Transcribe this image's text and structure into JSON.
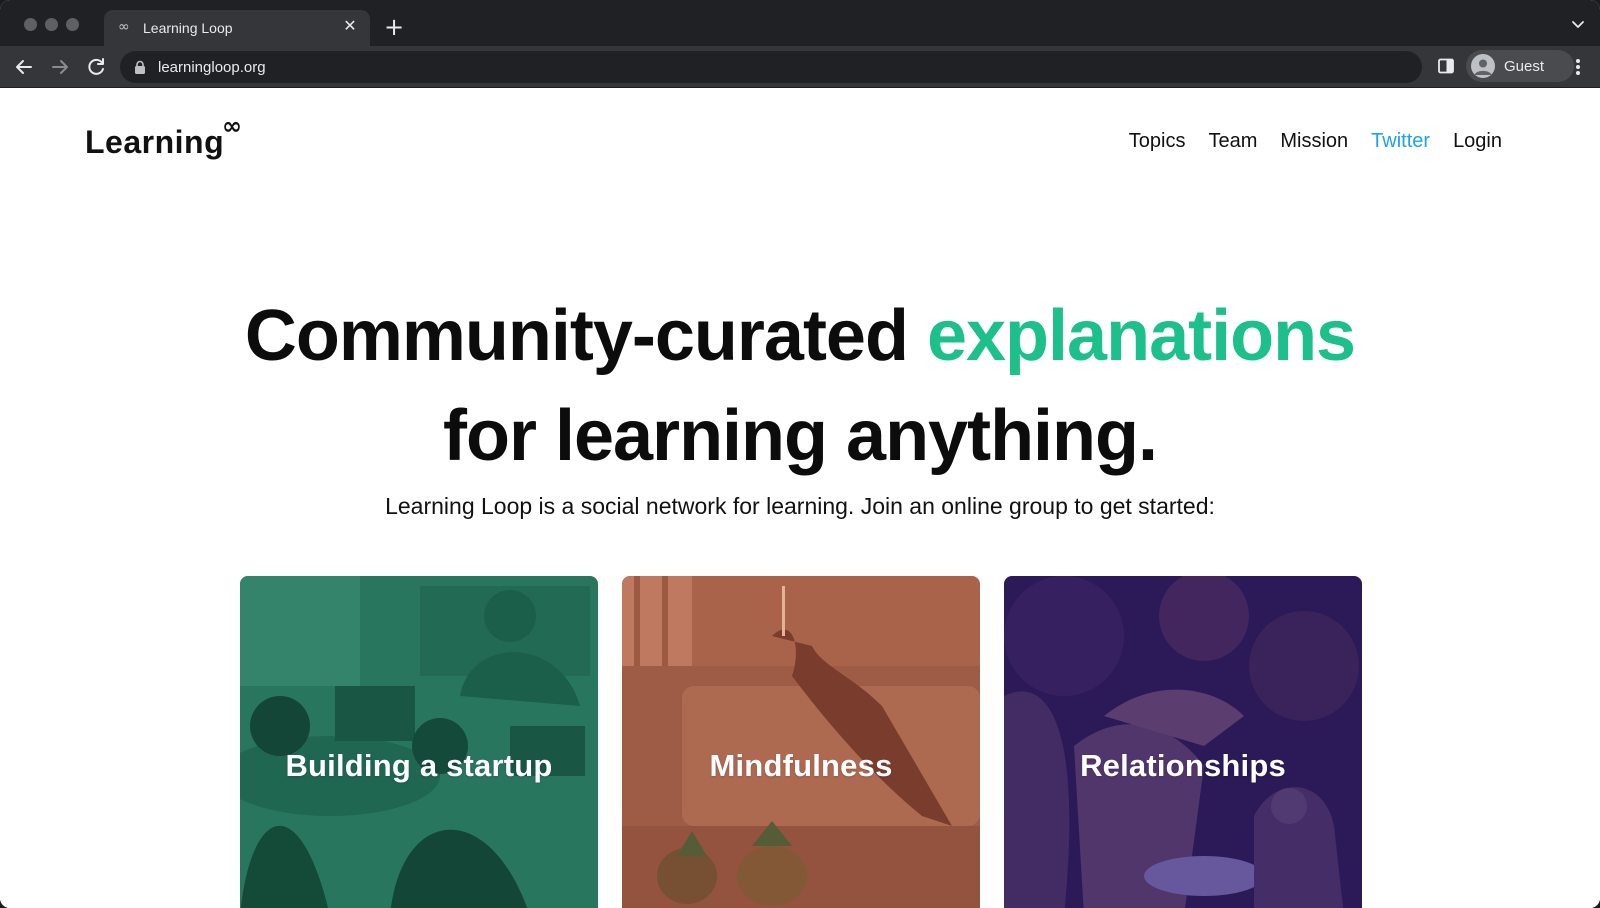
{
  "browser": {
    "tab_title": "Learning Loop",
    "tab_favicon": "∞",
    "url": "learningloop.org",
    "profile_name": "Guest"
  },
  "site": {
    "logo_text": "Learning",
    "logo_mark": "∞",
    "nav": [
      "Topics",
      "Team",
      "Mission",
      "Twitter",
      "Login"
    ]
  },
  "hero": {
    "line1_start": "Community-curated ",
    "line1_accent": "explanations",
    "line2": "for learning anything.",
    "subtitle": "Learning Loop is a social network for learning. Join an online group to get started:"
  },
  "cards": [
    {
      "label": "Building a startup",
      "tint": "#1f6b55"
    },
    {
      "label": "Mindfulness",
      "tint": "#a9634c"
    },
    {
      "label": "Relationships",
      "tint": "#2f1c5e"
    }
  ],
  "colors": {
    "accent": "#1dbf8a",
    "twitter": "#1da1f2",
    "chrome_dark": "#202124",
    "chrome_toolbar": "#35363a"
  },
  "icons": {
    "back": "arrow-left-icon",
    "forward": "arrow-right-icon",
    "reload": "reload-icon",
    "lock": "lock-icon",
    "side_panel": "side-panel-icon",
    "menu": "kebab-menu-icon",
    "tab_close": "close-icon",
    "new_tab": "plus-icon",
    "tab_list": "chevron-down-icon"
  }
}
